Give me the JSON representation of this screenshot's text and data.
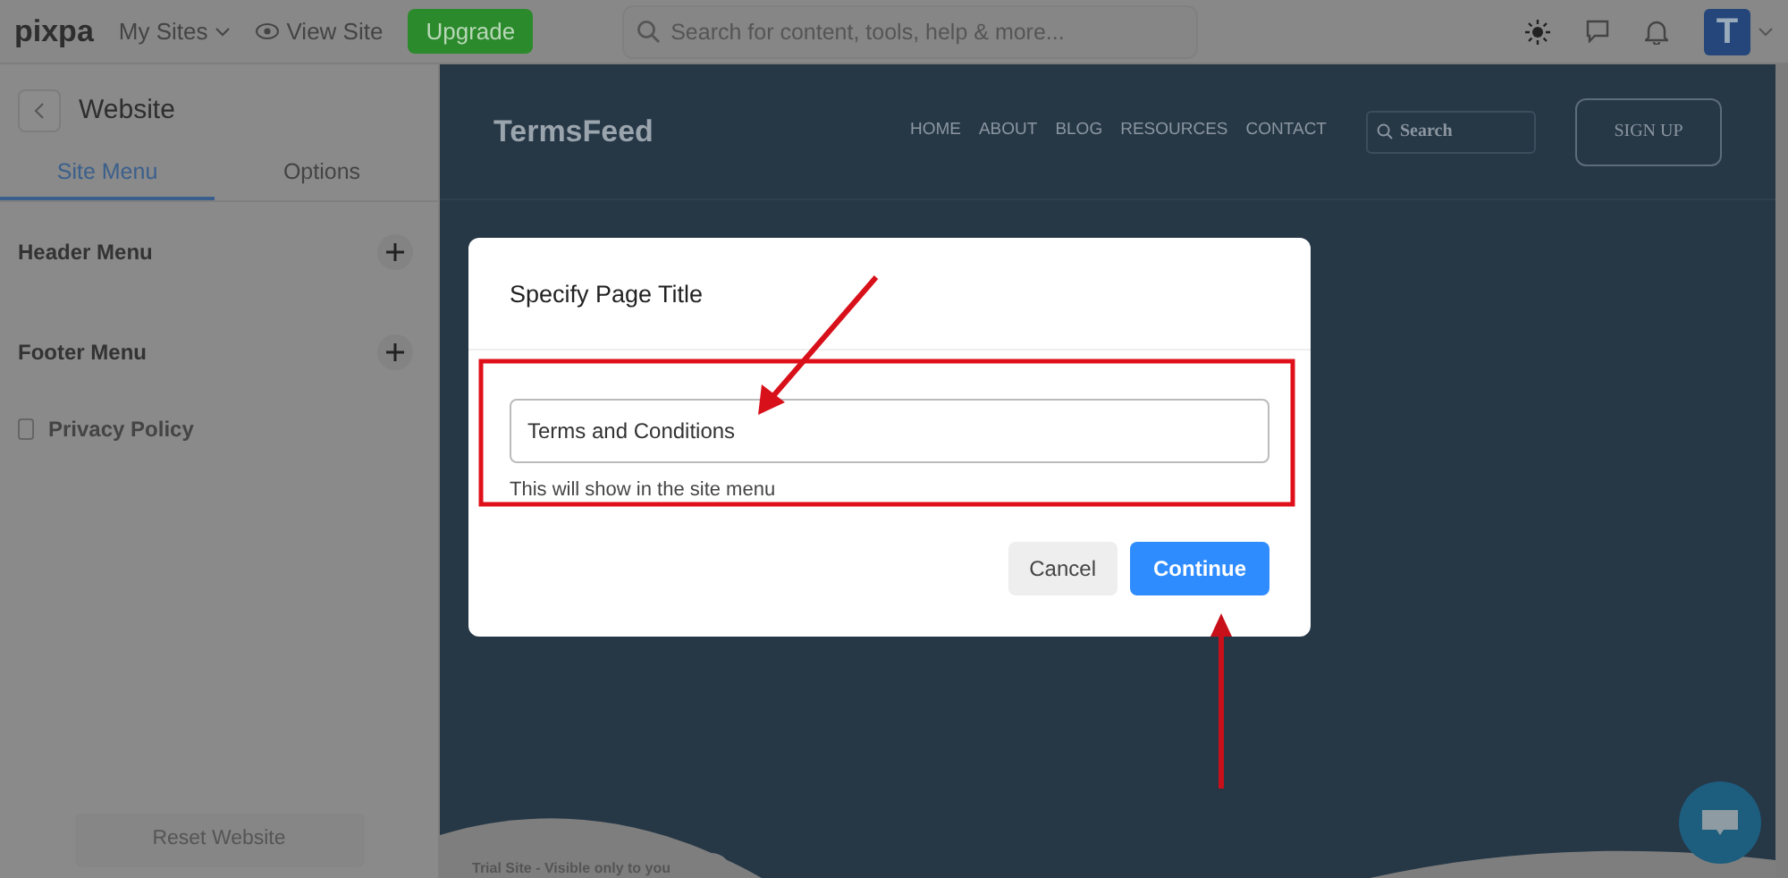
{
  "top_bar": {
    "logo": "pixpa",
    "nav": [
      {
        "label": "My Sites",
        "kind": "dropdown"
      },
      {
        "label": "View Site",
        "kind": "eye"
      }
    ],
    "upgrade": "Upgrade",
    "search": {
      "placeholder": "Search for content, tools, help & more..."
    },
    "avatar": "T"
  },
  "sidebar": {
    "title": "Website",
    "tabs": [
      {
        "label": "Site Menu",
        "selected": true
      },
      {
        "label": "Options",
        "selected": false
      }
    ],
    "items": [
      {
        "kind": "menu",
        "label": "Header Menu"
      },
      {
        "kind": "menu",
        "label": "Footer Menu"
      },
      {
        "kind": "page",
        "label": "Privacy Policy"
      }
    ],
    "reset": "Reset Website"
  },
  "preview": {
    "brand": "TermsFeed",
    "nav": [
      "HOME",
      "ABOUT",
      "BLOG",
      "RESOURCES",
      "CONTACT"
    ],
    "search": {
      "placeholder": "Search"
    },
    "signup": "SIGN UP",
    "notice": "Trial Site - Visible only to you"
  },
  "dialog": {
    "title": "Specify Page Title",
    "field": {
      "value": "Terms and Conditions"
    },
    "help": "This will show in the site menu",
    "buttons": [
      {
        "label": "Cancel",
        "kind": "secondary"
      },
      {
        "label": "Continue",
        "kind": "primary"
      }
    ]
  }
}
